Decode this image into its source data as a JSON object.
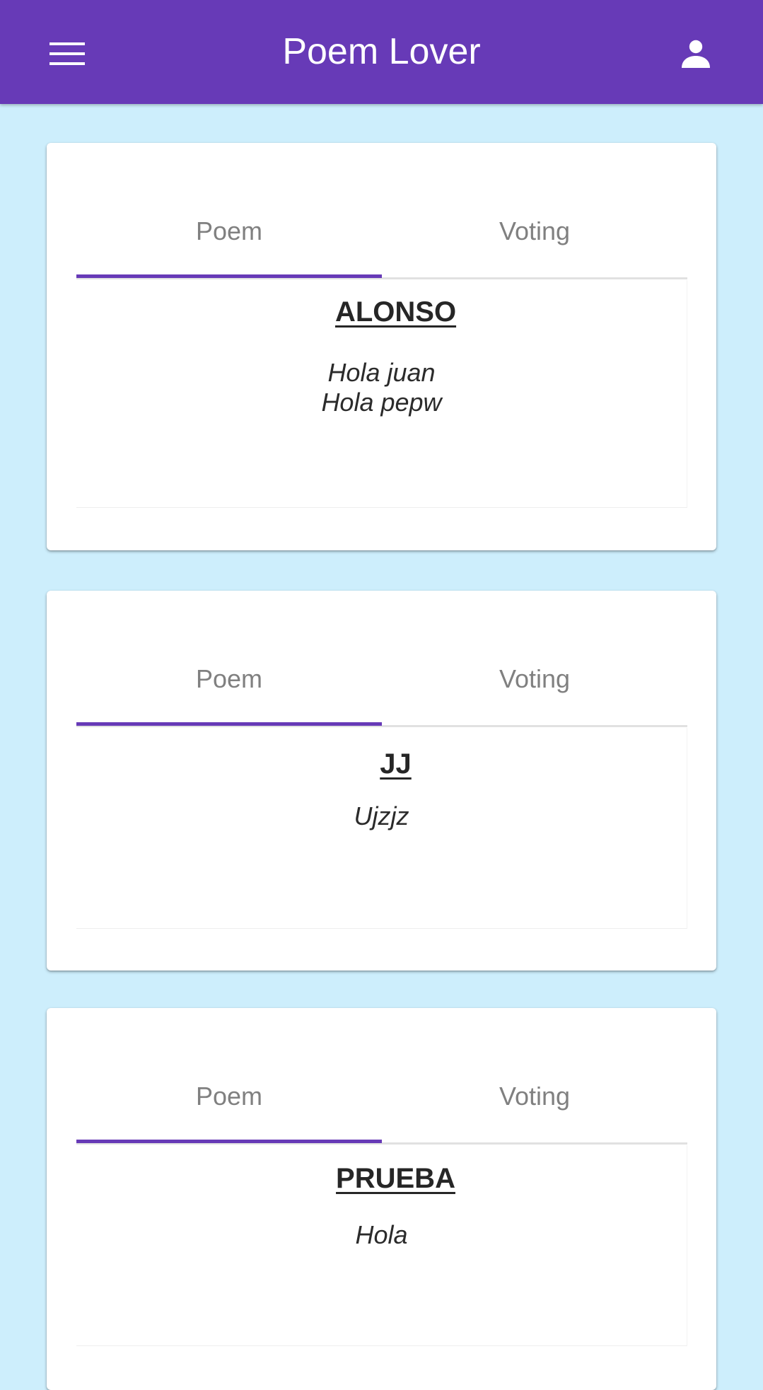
{
  "appbar": {
    "title": "Poem Lover",
    "menu_icon": "menu-icon",
    "account_icon": "account-icon",
    "color": "#673ab7"
  },
  "background_color": "#cdeefc",
  "cards": [
    {
      "tabs": [
        {
          "label": "Poem",
          "selected": true
        },
        {
          "label": "Voting",
          "selected": false
        }
      ],
      "poem": {
        "title": "ALONSO",
        "lines": [
          "Hola juan",
          "Hola pepw"
        ]
      }
    },
    {
      "tabs": [
        {
          "label": "Poem",
          "selected": true
        },
        {
          "label": "Voting",
          "selected": false
        }
      ],
      "poem": {
        "title": "JJ",
        "lines": [
          "Ujzjz"
        ]
      }
    },
    {
      "tabs": [
        {
          "label": "Poem",
          "selected": true
        },
        {
          "label": "Voting",
          "selected": false
        }
      ],
      "poem": {
        "title": "PRUEBA",
        "lines": [
          "Hola"
        ]
      }
    }
  ]
}
